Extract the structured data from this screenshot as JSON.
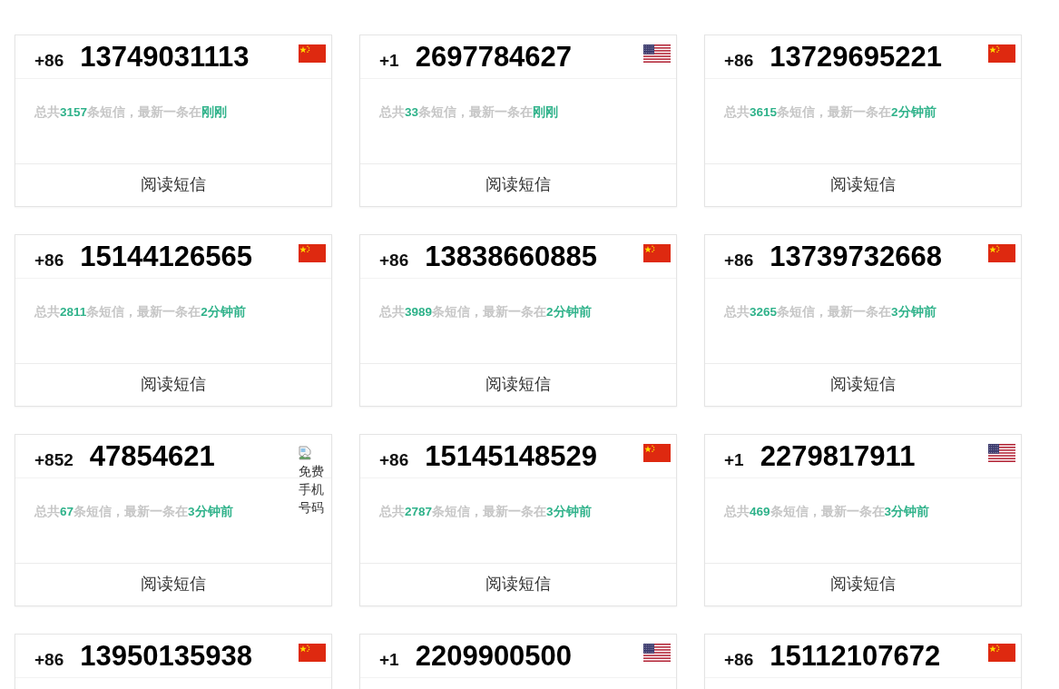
{
  "cards": [
    {
      "country_code": "+86",
      "number": "13749031113",
      "flag": {
        "kind": "cn"
      },
      "summary": {
        "prefix": "总共",
        "count": "3157",
        "middle": "条短信，最新一条在",
        "latest": "刚刚"
      },
      "action": "阅读短信"
    },
    {
      "country_code": "+1",
      "number": "2697784627",
      "flag": {
        "kind": "us"
      },
      "summary": {
        "prefix": "总共",
        "count": "33",
        "middle": "条短信，最新一条在",
        "latest": "刚刚"
      },
      "action": "阅读短信"
    },
    {
      "country_code": "+86",
      "number": "13729695221",
      "flag": {
        "kind": "cn"
      },
      "summary": {
        "prefix": "总共",
        "count": "3615",
        "middle": "条短信，最新一条在",
        "latest": "2分钟前"
      },
      "action": "阅读短信"
    },
    {
      "country_code": "+86",
      "number": "15144126565",
      "flag": {
        "kind": "cn"
      },
      "summary": {
        "prefix": "总共",
        "count": "2811",
        "middle": "条短信，最新一条在",
        "latest": "2分钟前"
      },
      "action": "阅读短信"
    },
    {
      "country_code": "+86",
      "number": "13838660885",
      "flag": {
        "kind": "cn"
      },
      "summary": {
        "prefix": "总共",
        "count": "3989",
        "middle": "条短信，最新一条在",
        "latest": "2分钟前"
      },
      "action": "阅读短信"
    },
    {
      "country_code": "+86",
      "number": "13739732668",
      "flag": {
        "kind": "cn"
      },
      "summary": {
        "prefix": "总共",
        "count": "3265",
        "middle": "条短信，最新一条在",
        "latest": "3分钟前"
      },
      "action": "阅读短信"
    },
    {
      "country_code": "+852",
      "number": "47854621",
      "flag": {
        "kind": "missing_image",
        "alt": "免费手机号码"
      },
      "summary": {
        "prefix": "总共",
        "count": "67",
        "middle": "条短信，最新一条在",
        "latest": "3分钟前"
      },
      "action": "阅读短信"
    },
    {
      "country_code": "+86",
      "number": "15145148529",
      "flag": {
        "kind": "cn"
      },
      "summary": {
        "prefix": "总共",
        "count": "2787",
        "middle": "条短信，最新一条在",
        "latest": "3分钟前"
      },
      "action": "阅读短信"
    },
    {
      "country_code": "+1",
      "number": "2279817911",
      "flag": {
        "kind": "us"
      },
      "summary": {
        "prefix": "总共",
        "count": "469",
        "middle": "条短信，最新一条在",
        "latest": "3分钟前"
      },
      "action": "阅读短信"
    },
    {
      "country_code": "+86",
      "number": "13950135938",
      "flag": {
        "kind": "cn"
      }
    },
    {
      "country_code": "+1",
      "number": "2209900500",
      "flag": {
        "kind": "us"
      }
    },
    {
      "country_code": "+86",
      "number": "15112107672",
      "flag": {
        "kind": "cn"
      }
    }
  ]
}
